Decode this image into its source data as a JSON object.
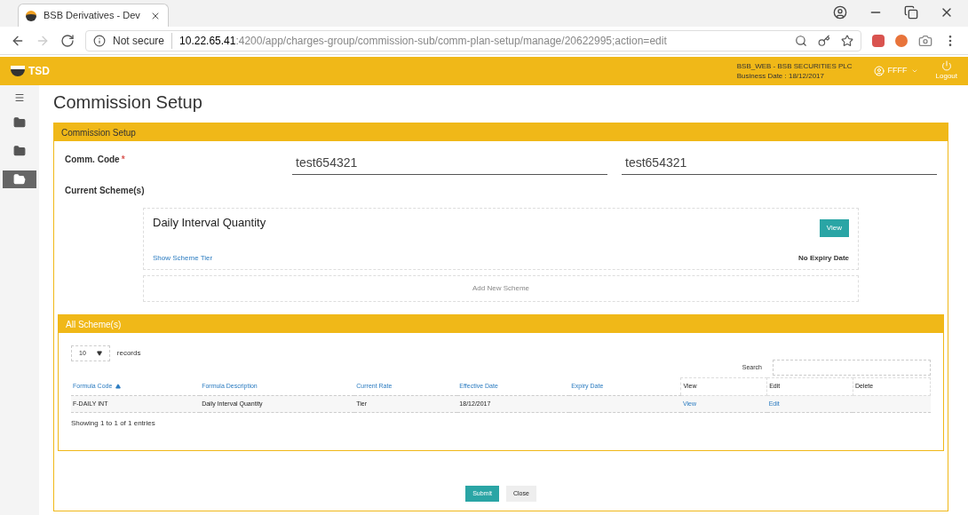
{
  "browser": {
    "tab_title": "BSB Derivatives - Dev",
    "security": "Not secure",
    "host": "10.22.65.41",
    "path": ":4200/app/charges-group/commission-sub/comm-plan-setup/manage/20622995;action=edit"
  },
  "header": {
    "logo": "TSD",
    "company": "BSB_WEB - BSB SECURITIES PLC",
    "business_date": "Business Date : 18/12/2017",
    "user": "FFFF",
    "logout": "Logout"
  },
  "sidebar": {
    "items": [
      {
        "kind": "folder",
        "selected": false
      },
      {
        "kind": "folder",
        "selected": false
      },
      {
        "kind": "open-folder",
        "selected": true
      }
    ]
  },
  "page_title": "Commission Setup",
  "panel": {
    "title": "Commission Setup",
    "comm_code": {
      "label": "Comm. Code",
      "required": "*",
      "values": [
        "test654321",
        "test654321"
      ]
    },
    "current_schemes_label": "Current Scheme(s)",
    "scheme_card": {
      "title": "Daily Interval Quantity",
      "view_button": "View",
      "link": "Show Scheme Tier",
      "expiry": "No Expiry Date"
    },
    "add_new": "Add New Scheme",
    "all_schemes": {
      "title": "All Scheme(s)",
      "page_size": "10",
      "records_label": "records",
      "search_label": "Search",
      "columns": [
        {
          "label": "Formula Code",
          "kind": "sortable",
          "sorted": true
        },
        {
          "label": "Formula Description",
          "kind": "sortable",
          "sorted": false
        },
        {
          "label": "Current Rate",
          "kind": "sortable",
          "sorted": false
        },
        {
          "label": "Effective Date",
          "kind": "sortable",
          "sorted": false
        },
        {
          "label": "Expiry Date",
          "kind": "sortable",
          "sorted": false
        },
        {
          "label": "View",
          "kind": "plain",
          "sorted": false
        },
        {
          "label": "Edit",
          "kind": "plain",
          "sorted": false
        },
        {
          "label": "Delete",
          "kind": "plain",
          "sorted": false
        }
      ],
      "rows": [
        {
          "cells": [
            {
              "text": "F-DAILY INT",
              "kind": "text"
            },
            {
              "text": "Daily Interval Quantity",
              "kind": "text"
            },
            {
              "text": "Tier",
              "kind": "text"
            },
            {
              "text": "18/12/2017",
              "kind": "text"
            },
            {
              "kind": "empty"
            },
            {
              "text": "View",
              "kind": "link"
            },
            {
              "text": "Edit",
              "kind": "link"
            },
            {
              "kind": "empty"
            }
          ]
        }
      ],
      "info": "Showing 1 to 1 of 1 entries"
    }
  },
  "buttons": {
    "submit": "Submit",
    "close": "Close"
  }
}
